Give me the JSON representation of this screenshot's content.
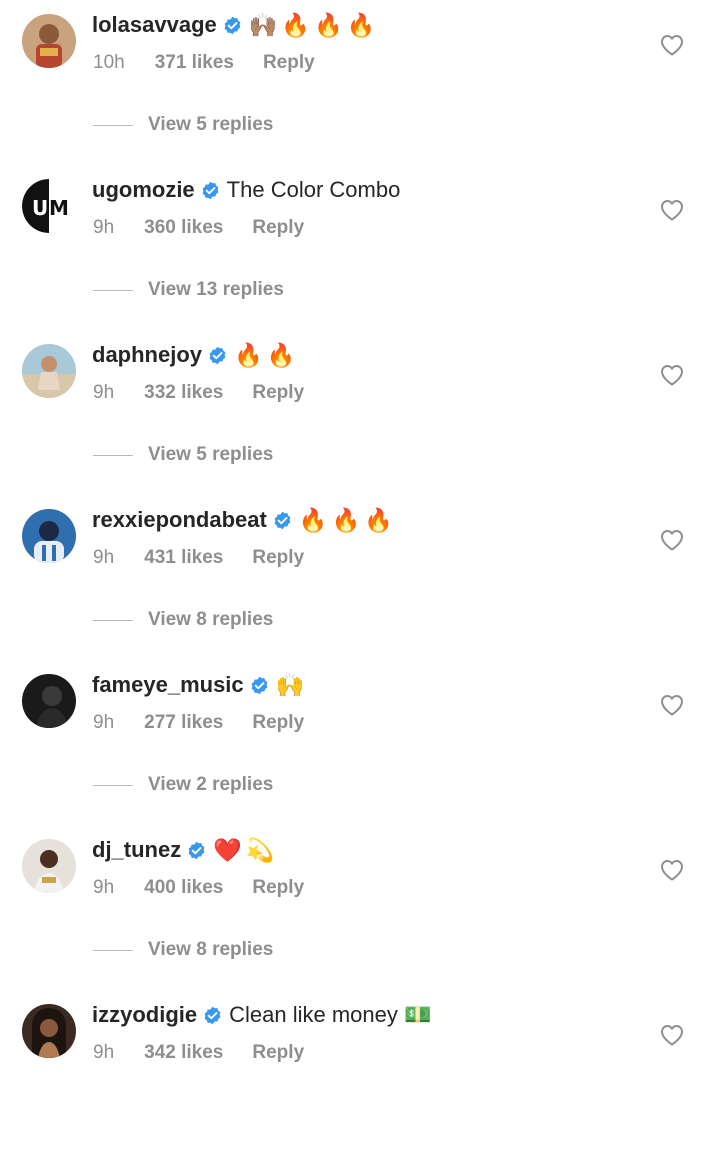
{
  "colors": {
    "text": "#262626",
    "secondary": "#8e8e8e",
    "verified_blue": "#3897f0"
  },
  "comments": [
    {
      "username": "lolasavvage",
      "verified": true,
      "text": "🙌🏽🔥🔥🔥",
      "time": "10h",
      "likes": "371 likes",
      "reply_label": "Reply",
      "view_replies": "View 5 replies",
      "avatar_icon": "avatar-photo-woman"
    },
    {
      "username": "ugomozie",
      "verified": true,
      "text": "The Color Combo",
      "time": "9h",
      "likes": "360 likes",
      "reply_label": "Reply",
      "view_replies": "View 13 replies",
      "avatar_icon": "avatar-logo-um"
    },
    {
      "username": "daphnejoy",
      "verified": true,
      "text": "🔥🔥",
      "time": "9h",
      "likes": "332 likes",
      "reply_label": "Reply",
      "view_replies": "View 5 replies",
      "avatar_icon": "avatar-photo-beach"
    },
    {
      "username": "rexxiepondabeat",
      "verified": true,
      "text": "🔥🔥🔥",
      "time": "9h",
      "likes": "431 likes",
      "reply_label": "Reply",
      "view_replies": "View 8 replies",
      "avatar_icon": "avatar-photo-blue"
    },
    {
      "username": "fameye_music",
      "verified": true,
      "text": "🙌",
      "time": "9h",
      "likes": "277 likes",
      "reply_label": "Reply",
      "view_replies": "View 2 replies",
      "avatar_icon": "avatar-photo-dark"
    },
    {
      "username": "dj_tunez",
      "verified": true,
      "text": "❤️💫",
      "time": "9h",
      "likes": "400 likes",
      "reply_label": "Reply",
      "view_replies": "View 8 replies",
      "avatar_icon": "avatar-photo-man"
    },
    {
      "username": "izzyodigie",
      "verified": true,
      "text": "Clean like money 💵",
      "time": "9h",
      "likes": "342 likes",
      "reply_label": "Reply",
      "view_replies": "",
      "avatar_icon": "avatar-photo-woman-dark"
    }
  ]
}
